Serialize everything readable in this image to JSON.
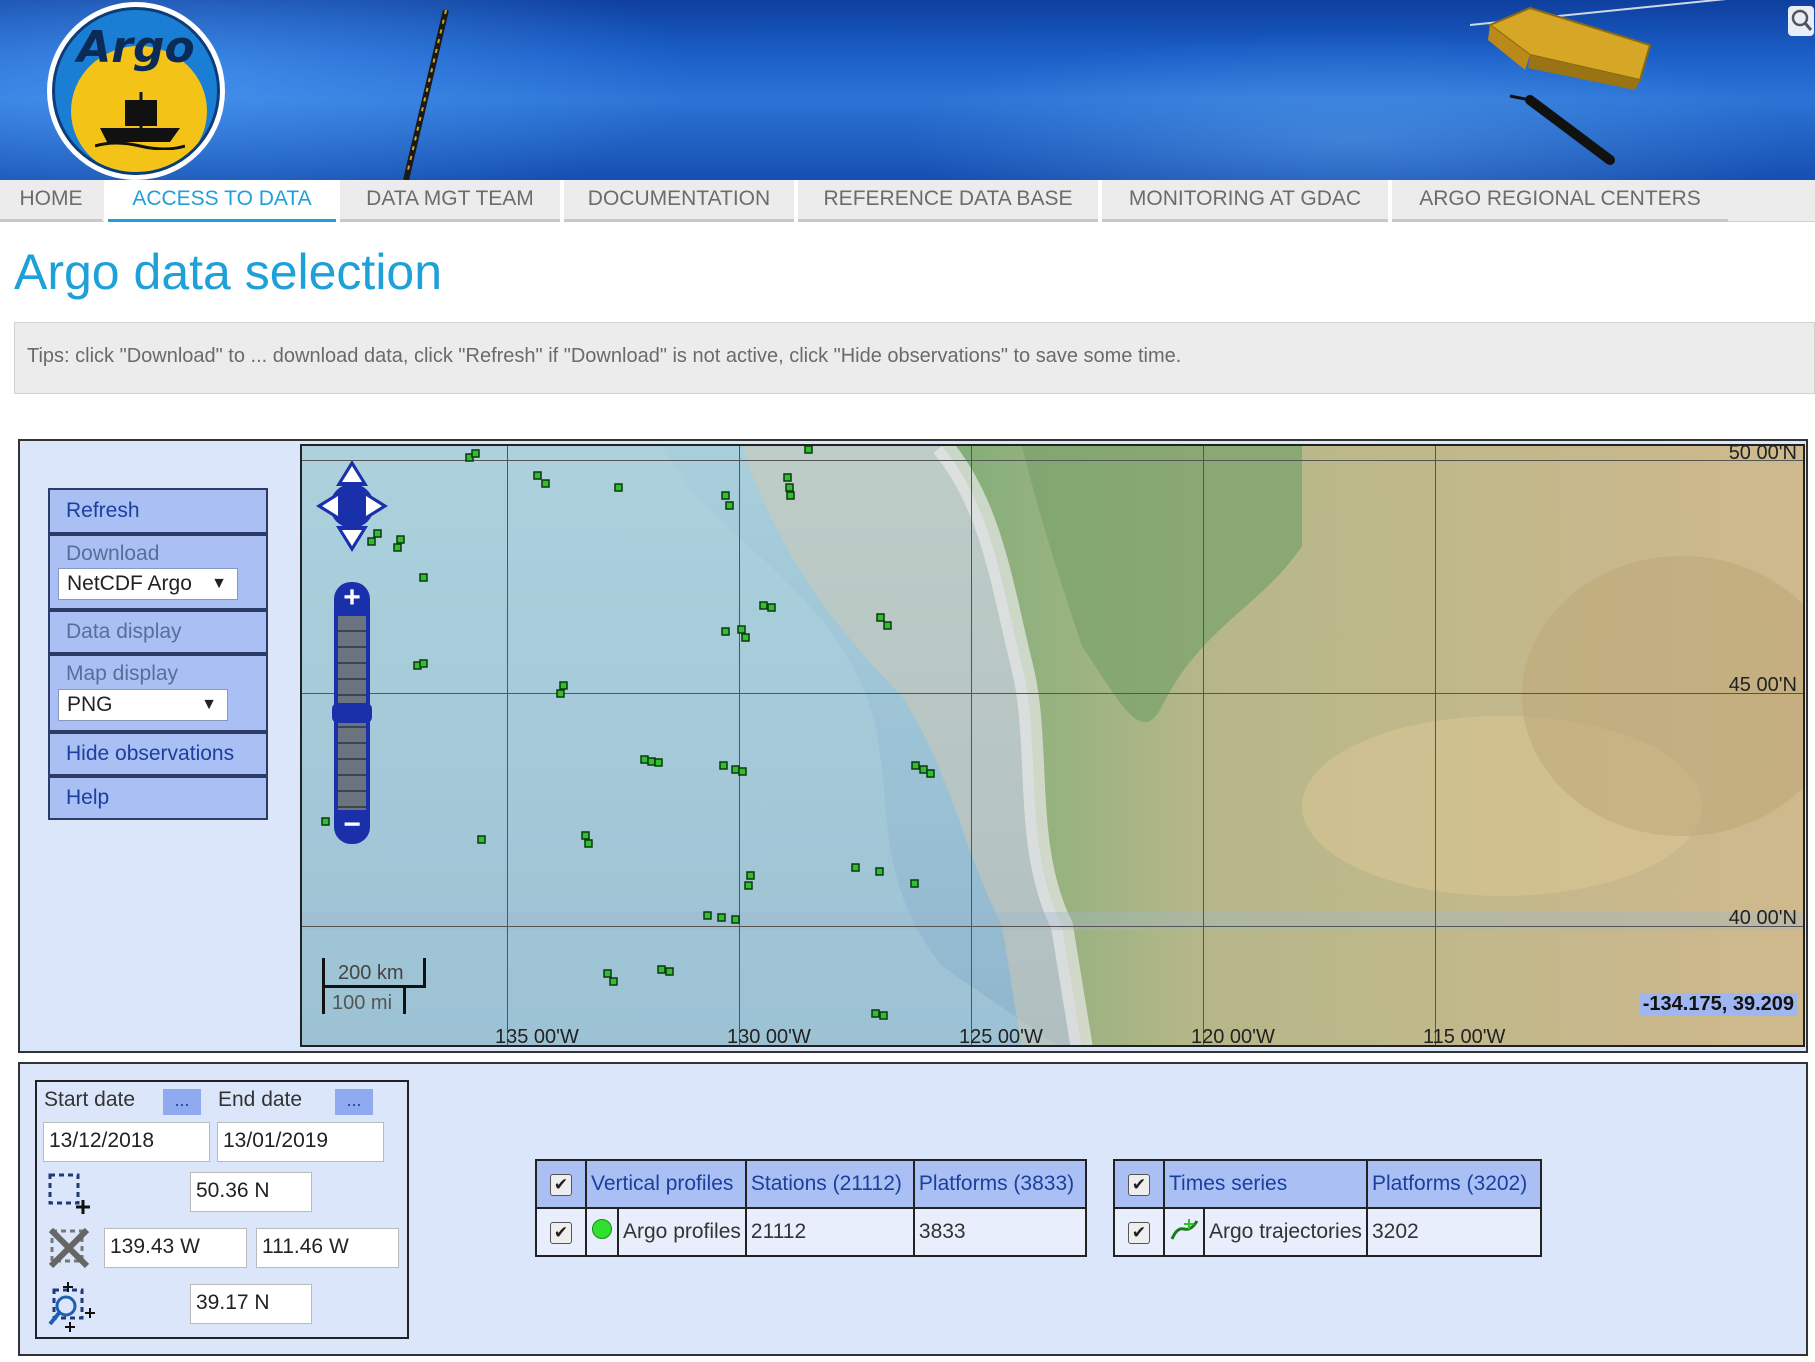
{
  "header": {
    "logo_text": "Argo"
  },
  "nav": {
    "items": [
      "HOME",
      "ACCESS TO DATA",
      "DATA MGT TEAM",
      "DOCUMENTATION",
      "REFERENCE DATA BASE",
      "MONITORING AT GDAC",
      "ARGO REGIONAL CENTERS"
    ],
    "active": "ACCESS TO DATA"
  },
  "page": {
    "title": "Argo data selection",
    "tips": "Tips: click \"Download\" to ... download data, click \"Refresh\" if \"Download\" is not active, click \"Hide observations\" to save some time."
  },
  "sidebar": {
    "refresh": "Refresh",
    "download": "Download",
    "download_format": "NetCDF Argo",
    "data_display": "Data display",
    "map_display": "Map display",
    "map_format": "PNG",
    "hide_observations": "Hide observations",
    "help": "Help"
  },
  "map": {
    "lat_labels": [
      "50 00'N",
      "45 00'N",
      "40 00'N"
    ],
    "lon_labels": [
      "135 00'W",
      "130 00'W",
      "125 00'W",
      "120 00'W",
      "115 00'W"
    ],
    "scale_km": "200 km",
    "scale_mi": "100 mi",
    "cursor_coords": "-134.175, 39.209",
    "colors": {
      "ocean": "#9cc4d6",
      "land": "#c9b489",
      "markers": "#2fbf2f"
    }
  },
  "dates": {
    "start_label": "Start date",
    "end_label": "End date",
    "picker_label": "...",
    "start_value": "13/12/2018",
    "end_value": "13/01/2019",
    "north": "50.36 N",
    "west": "139.43 W",
    "east": "111.46 W",
    "south": "39.17 N"
  },
  "profiles_table": {
    "headers": [
      "Vertical profiles",
      "Stations (21112)",
      "Platforms (3833)"
    ],
    "row": {
      "name": "Argo profiles",
      "stations": "21112",
      "platforms": "3833"
    }
  },
  "timeseries_table": {
    "headers": [
      "Times series",
      "Platforms (3202)"
    ],
    "row": {
      "name": "Argo trajectories",
      "platforms": "3202"
    }
  }
}
